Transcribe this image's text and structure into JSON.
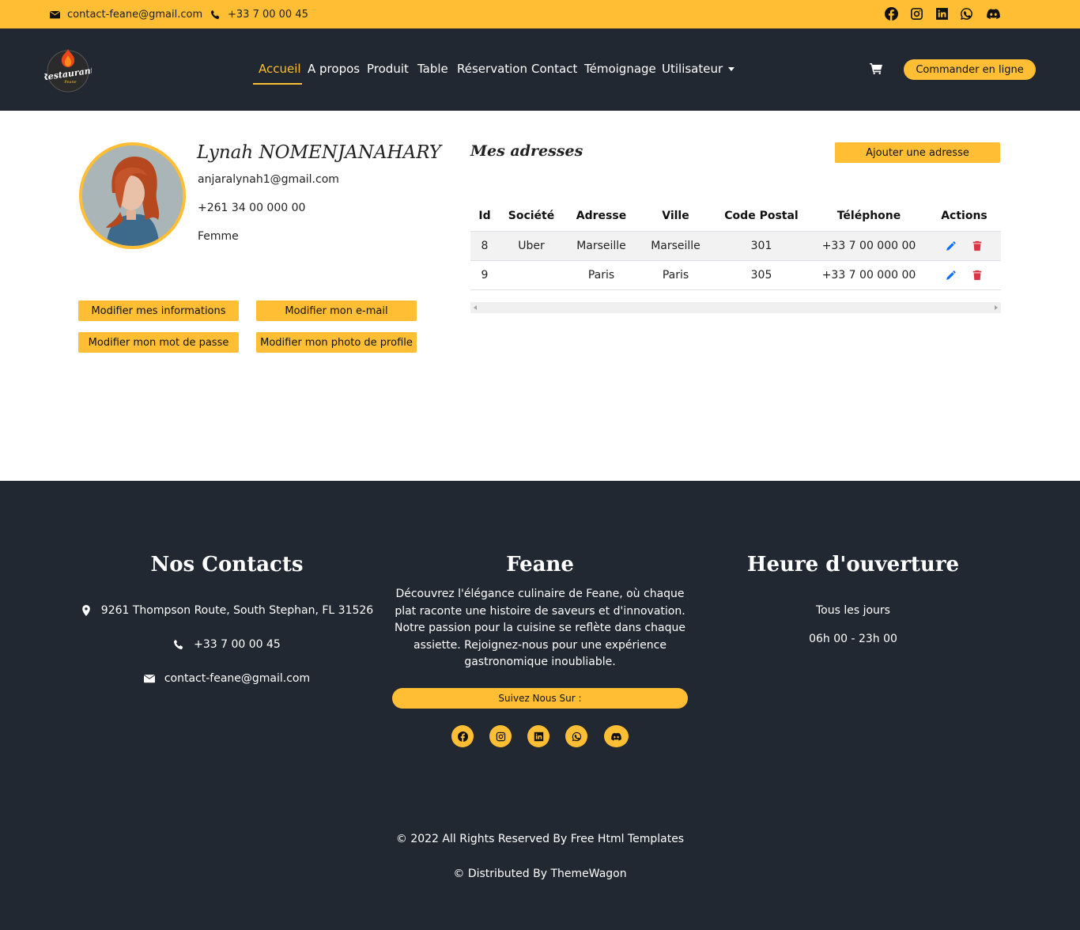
{
  "topbar": {
    "email": "contact-feane@gmail.com",
    "phone": "+33 7 00 00 45",
    "socials": [
      "facebook-icon",
      "instagram-icon",
      "linkedin-icon",
      "whatsapp-icon",
      "discord-icon"
    ]
  },
  "header": {
    "logo_text": "Restaurant",
    "logo_sub": "Feane",
    "nav": [
      {
        "label": "Accueil",
        "active": true
      },
      {
        "label": "A propos"
      },
      {
        "label": "Produit"
      },
      {
        "label": "Table"
      },
      {
        "label": "Réservation"
      },
      {
        "label": "Contact"
      },
      {
        "label": "Témoignage"
      },
      {
        "label": "Utilisateur"
      }
    ],
    "order_label": "Commander en ligne"
  },
  "profile": {
    "name": "Lynah NOMENJANAHARY",
    "email": "anjaralynah1@gmail.com",
    "phone": "+261 34 00 000 00",
    "gender": "Femme",
    "buttons": {
      "edit_info": "Modifier mes informations",
      "edit_email": "Modifier mon e-mail",
      "edit_password": "Modifier mon mot de passe",
      "edit_photo": "Modifier mon photo de profile"
    }
  },
  "addresses": {
    "title": "Mes adresses",
    "add_label": "Ajouter une adresse",
    "columns": [
      "Id",
      "Société",
      "Adresse",
      "Ville",
      "Code Postal",
      "Téléphone",
      "Actions"
    ],
    "rows": [
      [
        "8",
        "Uber",
        "Marseille",
        "Marseille",
        "301",
        "+33 7 00 000 00"
      ],
      [
        "9",
        "",
        "Paris",
        "Paris",
        "305",
        "+33 7 00 000 00"
      ]
    ]
  },
  "footer": {
    "contacts_title": "Nos Contacts",
    "address": "9261 Thompson Route, South Stephan, FL 31526",
    "phone": "+33 7 00 00 45",
    "email": "contact-feane@gmail.com",
    "brand_title": "Feane",
    "description": "Découvrez l'élégance culinaire de Feane, où chaque plat raconte une histoire de saveurs et d'innovation. Notre passion pour la cuisine se reflète dans chaque assiette. Rejoignez-nous pour une expérience gastronomique inoubliable.",
    "follow_label": "Suivez Nous Sur :",
    "hours_title": "Heure d'ouverture",
    "hours_days": "Tous les jours",
    "hours_time": "06h 00 - 23h 00",
    "copyright": "© 2022 All Rights Reserved By Free Html Templates",
    "distributed": "© Distributed By ThemeWagon"
  },
  "colors": {
    "accent": "#ffbe33",
    "dark": "#222831",
    "edit": "#0d6efd",
    "delete": "#dc3545"
  }
}
